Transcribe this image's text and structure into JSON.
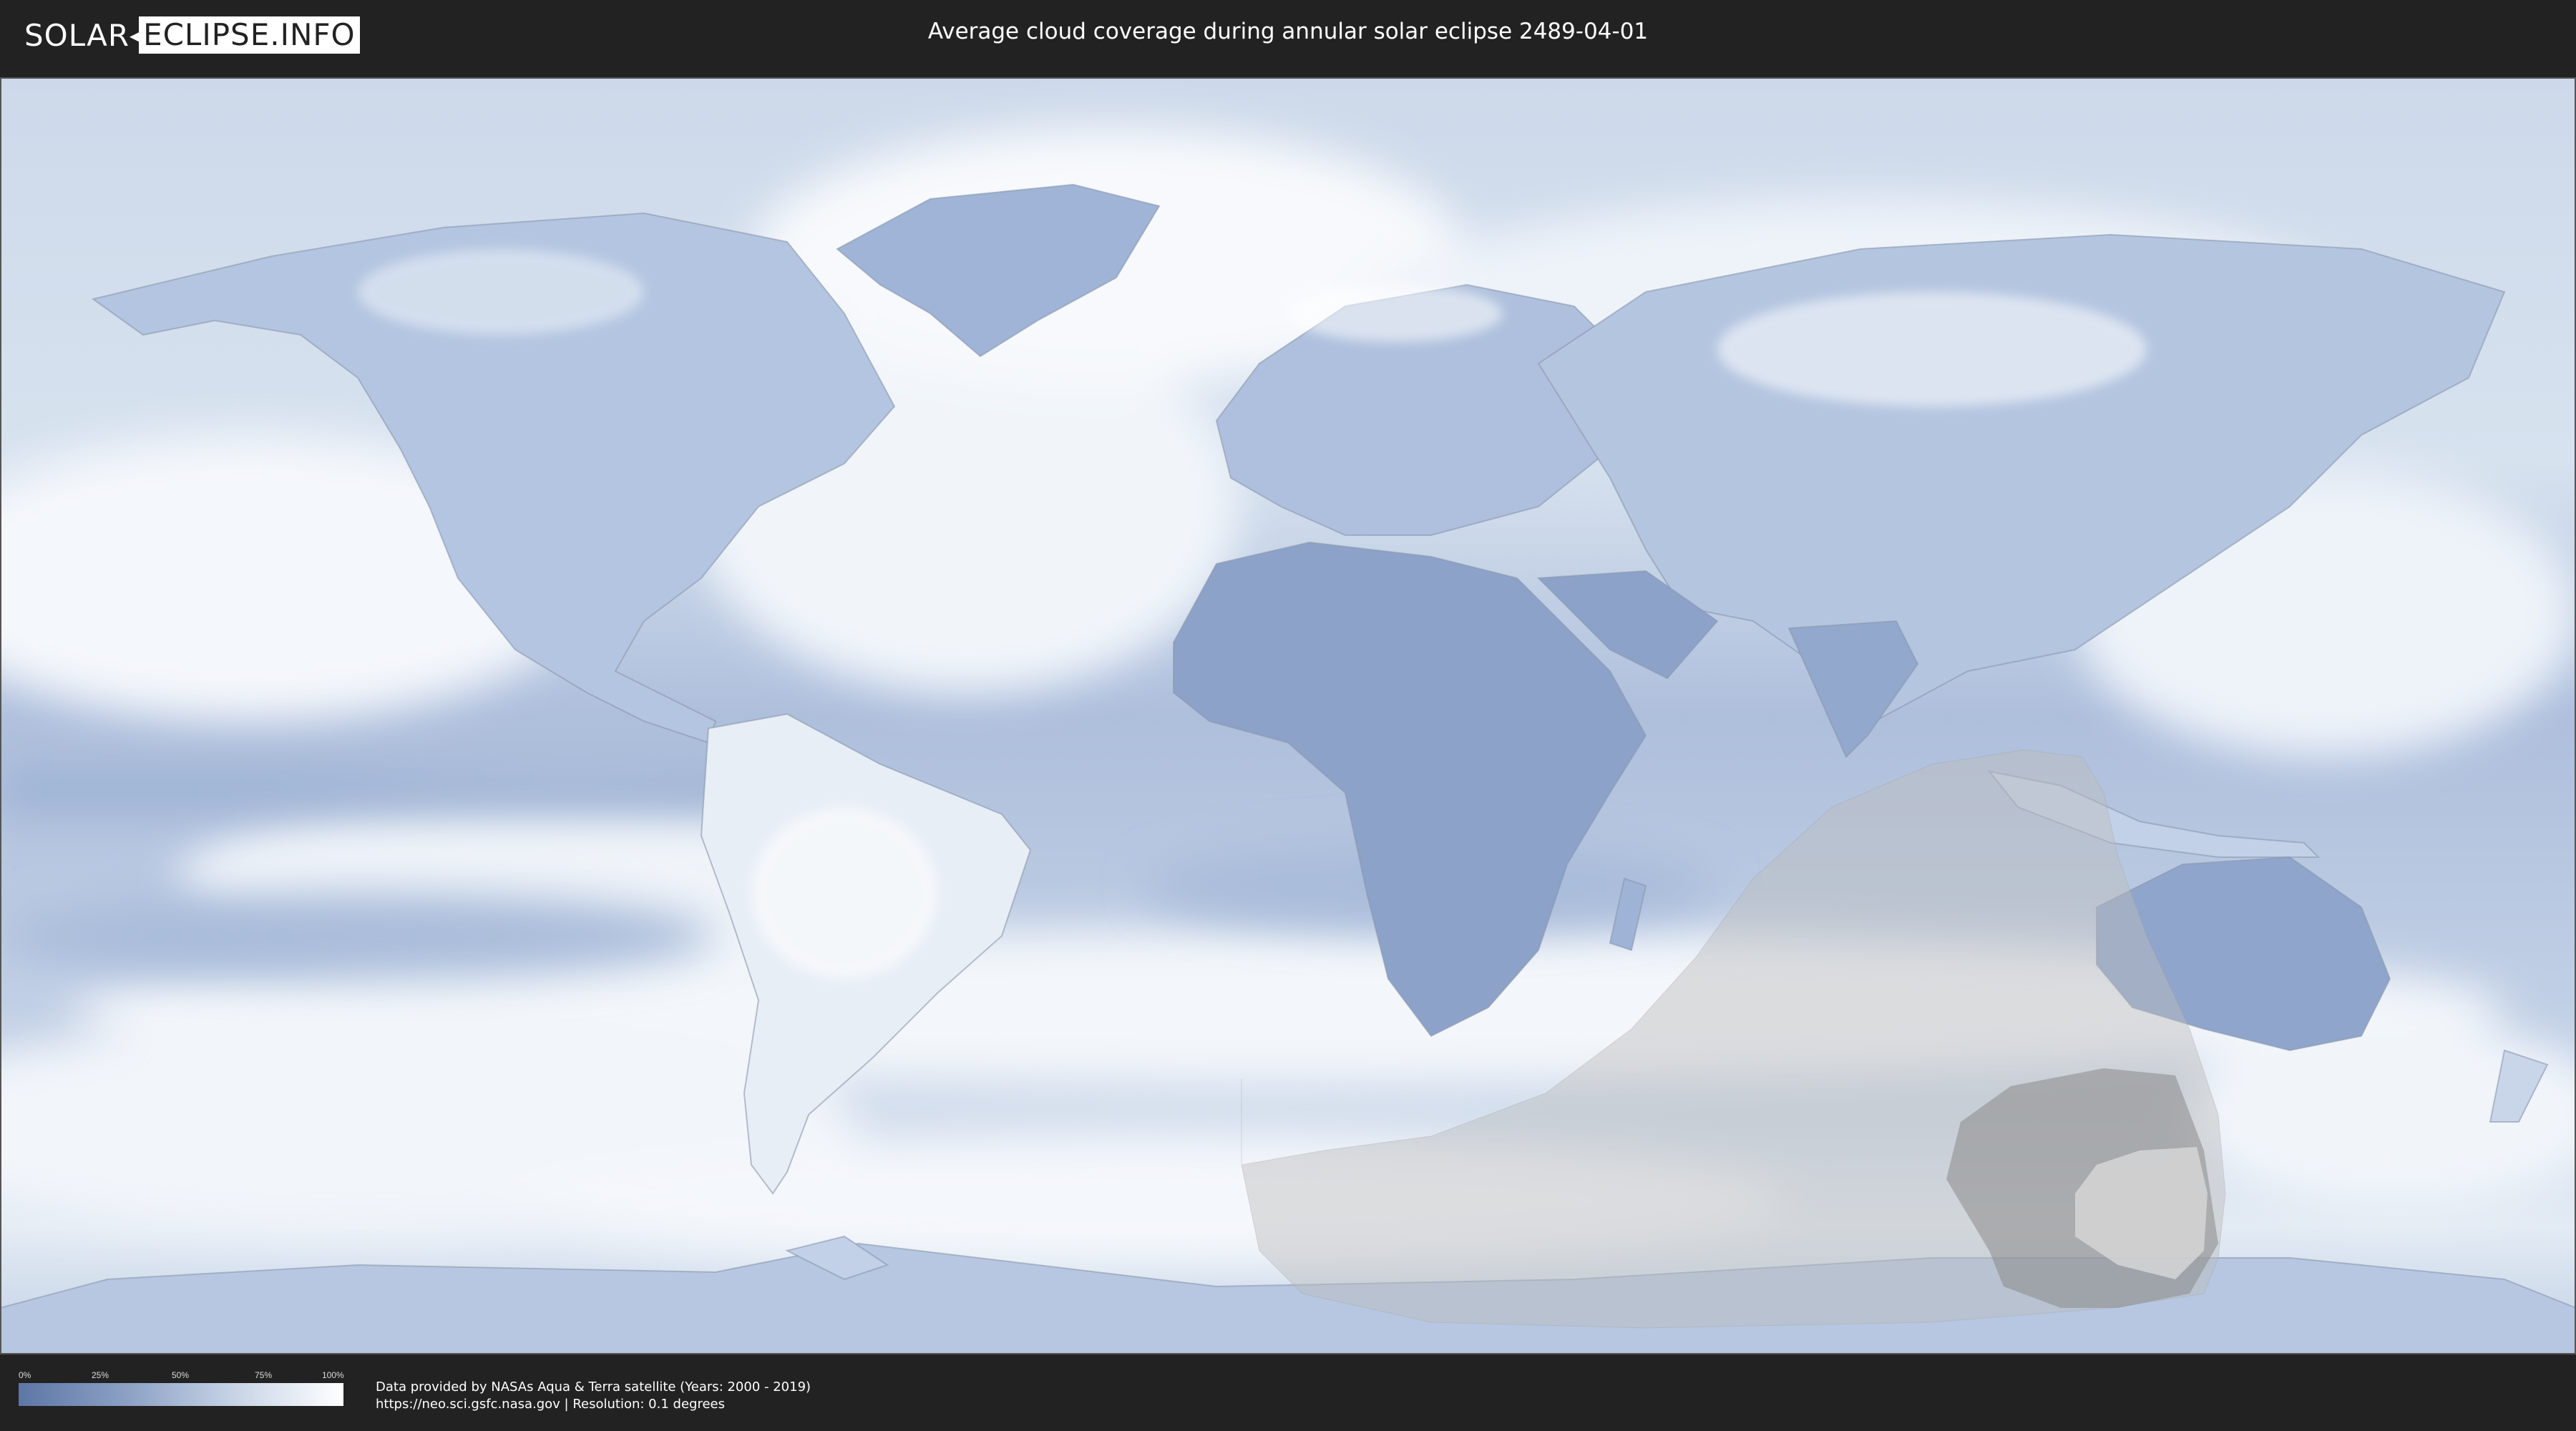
{
  "header": {
    "logo_left": "SOLAR",
    "logo_right": "ECLIPSE.INFO",
    "title": "Average cloud coverage during annular solar eclipse 2489-04-01"
  },
  "legend": {
    "ticks": [
      "0%",
      "25%",
      "50%",
      "75%",
      "100%"
    ],
    "colors": [
      "#5d76a6",
      "#8ea3c6",
      "#c5d2e5",
      "#ffffff"
    ]
  },
  "footer": {
    "credit_line1": "Data provided by NASAs Aqua & Terra satellite (Years: 2000 - 2019)",
    "credit_line2": "https://neo.sci.gsfc.nasa.gov | Resolution: 0.1 degrees"
  },
  "map": {
    "ocean_color": "#b9cbe3",
    "cloud_color": "#ffffff",
    "clear_land_color": "#6f87b4",
    "penumbra_color": "#bfbfbf",
    "annular_path_color": "#888888"
  }
}
